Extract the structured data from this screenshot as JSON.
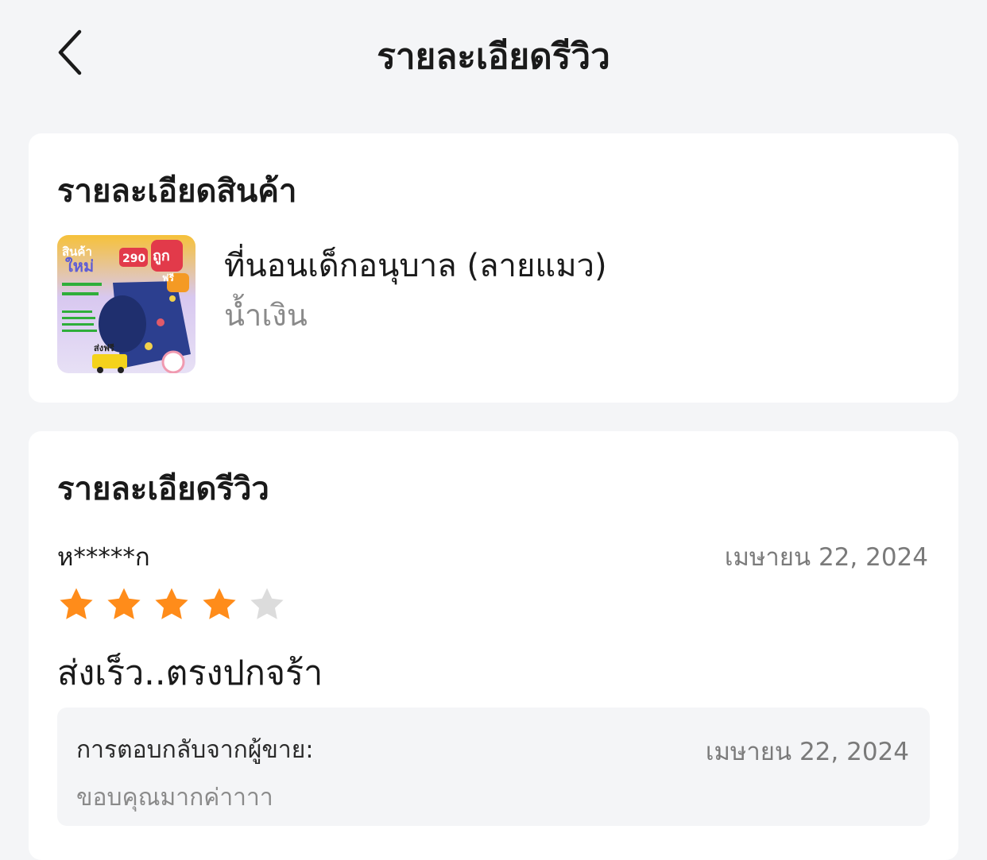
{
  "header": {
    "title": "รายละเอียดรีวิว",
    "back_icon": "chevron-left-icon"
  },
  "product_section": {
    "title": "รายละเอียดสินค้า",
    "product_name": "ที่นอนเด็กอนุบาล (ลายแมว)",
    "variant": "น้ำเงิน",
    "thumbnail_texts": [
      "สินค้า",
      "ใหม่",
      "290",
      "ถูก",
      "ฟรี",
      "ส่งฟรี"
    ]
  },
  "review_section": {
    "title": "รายละเอียดรีวิว",
    "reviewer": "ห*****ก",
    "date": "เมษายน 22, 2024",
    "rating": 4,
    "max_rating": 5,
    "text": "ส่งเร็ว..ตรงปกจร้า",
    "reply": {
      "label": "การตอบกลับจากผู้ขาย:",
      "date": "เมษายน 22, 2024",
      "text": "ขอบคุณมากค่าาาา"
    }
  },
  "colors": {
    "background": "#f4f5f7",
    "card": "#ffffff",
    "star_filled": "#ff8c1a",
    "star_empty": "#dcdcdc",
    "secondary_text": "#8a8a8a"
  }
}
